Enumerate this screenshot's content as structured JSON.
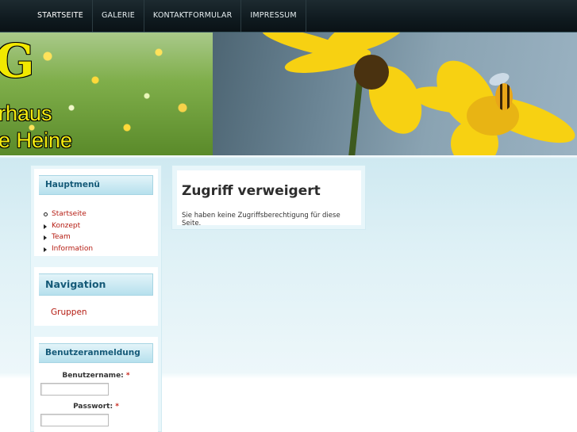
{
  "nav": {
    "items": [
      {
        "label": "STARTSEITE"
      },
      {
        "label": "GALERIE"
      },
      {
        "label": "KONTAKTFORMULAR"
      },
      {
        "label": "IMPRESSUM"
      }
    ]
  },
  "banner": {
    "logo_letter": "G",
    "title_line1": "rhaus",
    "title_line2": "e Heine"
  },
  "sidebar": {
    "main_menu": {
      "title": "Hauptmenü",
      "items": [
        {
          "label": "Startseite"
        },
        {
          "label": "Konzept"
        },
        {
          "label": "Team"
        },
        {
          "label": "Information"
        }
      ]
    },
    "navigation": {
      "title": "Navigation",
      "link": "Gruppen"
    },
    "login": {
      "title": "Benutzeranmeldung",
      "username_label": "Benutzername:",
      "password_label": "Passwort:",
      "required_mark": "*",
      "username_value": "",
      "password_value": ""
    }
  },
  "content": {
    "title": "Zugriff verweigert",
    "message": "Sie haben keine Zugriffsberechtigung für diese Seite."
  },
  "colors": {
    "link_red": "#b51c12",
    "header_blue": "#155a78",
    "nav_dark": "#0f1a1f"
  }
}
